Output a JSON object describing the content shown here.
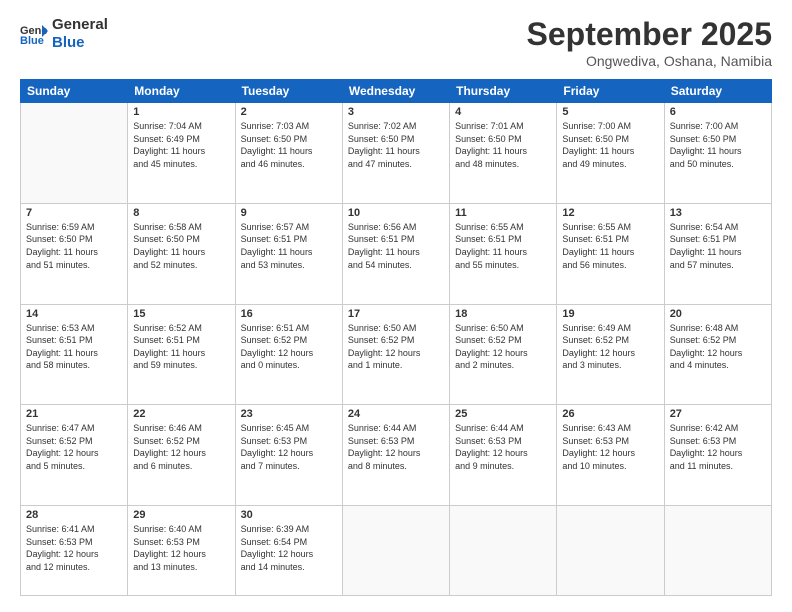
{
  "header": {
    "logo_line1": "General",
    "logo_line2": "Blue",
    "month": "September 2025",
    "location": "Ongwediva, Oshana, Namibia"
  },
  "weekdays": [
    "Sunday",
    "Monday",
    "Tuesday",
    "Wednesday",
    "Thursday",
    "Friday",
    "Saturday"
  ],
  "weeks": [
    [
      {
        "day": "",
        "text": ""
      },
      {
        "day": "1",
        "text": "Sunrise: 7:04 AM\nSunset: 6:49 PM\nDaylight: 11 hours\nand 45 minutes."
      },
      {
        "day": "2",
        "text": "Sunrise: 7:03 AM\nSunset: 6:50 PM\nDaylight: 11 hours\nand 46 minutes."
      },
      {
        "day": "3",
        "text": "Sunrise: 7:02 AM\nSunset: 6:50 PM\nDaylight: 11 hours\nand 47 minutes."
      },
      {
        "day": "4",
        "text": "Sunrise: 7:01 AM\nSunset: 6:50 PM\nDaylight: 11 hours\nand 48 minutes."
      },
      {
        "day": "5",
        "text": "Sunrise: 7:00 AM\nSunset: 6:50 PM\nDaylight: 11 hours\nand 49 minutes."
      },
      {
        "day": "6",
        "text": "Sunrise: 7:00 AM\nSunset: 6:50 PM\nDaylight: 11 hours\nand 50 minutes."
      }
    ],
    [
      {
        "day": "7",
        "text": "Sunrise: 6:59 AM\nSunset: 6:50 PM\nDaylight: 11 hours\nand 51 minutes."
      },
      {
        "day": "8",
        "text": "Sunrise: 6:58 AM\nSunset: 6:50 PM\nDaylight: 11 hours\nand 52 minutes."
      },
      {
        "day": "9",
        "text": "Sunrise: 6:57 AM\nSunset: 6:51 PM\nDaylight: 11 hours\nand 53 minutes."
      },
      {
        "day": "10",
        "text": "Sunrise: 6:56 AM\nSunset: 6:51 PM\nDaylight: 11 hours\nand 54 minutes."
      },
      {
        "day": "11",
        "text": "Sunrise: 6:55 AM\nSunset: 6:51 PM\nDaylight: 11 hours\nand 55 minutes."
      },
      {
        "day": "12",
        "text": "Sunrise: 6:55 AM\nSunset: 6:51 PM\nDaylight: 11 hours\nand 56 minutes."
      },
      {
        "day": "13",
        "text": "Sunrise: 6:54 AM\nSunset: 6:51 PM\nDaylight: 11 hours\nand 57 minutes."
      }
    ],
    [
      {
        "day": "14",
        "text": "Sunrise: 6:53 AM\nSunset: 6:51 PM\nDaylight: 11 hours\nand 58 minutes."
      },
      {
        "day": "15",
        "text": "Sunrise: 6:52 AM\nSunset: 6:51 PM\nDaylight: 11 hours\nand 59 minutes."
      },
      {
        "day": "16",
        "text": "Sunrise: 6:51 AM\nSunset: 6:52 PM\nDaylight: 12 hours\nand 0 minutes."
      },
      {
        "day": "17",
        "text": "Sunrise: 6:50 AM\nSunset: 6:52 PM\nDaylight: 12 hours\nand 1 minute."
      },
      {
        "day": "18",
        "text": "Sunrise: 6:50 AM\nSunset: 6:52 PM\nDaylight: 12 hours\nand 2 minutes."
      },
      {
        "day": "19",
        "text": "Sunrise: 6:49 AM\nSunset: 6:52 PM\nDaylight: 12 hours\nand 3 minutes."
      },
      {
        "day": "20",
        "text": "Sunrise: 6:48 AM\nSunset: 6:52 PM\nDaylight: 12 hours\nand 4 minutes."
      }
    ],
    [
      {
        "day": "21",
        "text": "Sunrise: 6:47 AM\nSunset: 6:52 PM\nDaylight: 12 hours\nand 5 minutes."
      },
      {
        "day": "22",
        "text": "Sunrise: 6:46 AM\nSunset: 6:52 PM\nDaylight: 12 hours\nand 6 minutes."
      },
      {
        "day": "23",
        "text": "Sunrise: 6:45 AM\nSunset: 6:53 PM\nDaylight: 12 hours\nand 7 minutes."
      },
      {
        "day": "24",
        "text": "Sunrise: 6:44 AM\nSunset: 6:53 PM\nDaylight: 12 hours\nand 8 minutes."
      },
      {
        "day": "25",
        "text": "Sunrise: 6:44 AM\nSunset: 6:53 PM\nDaylight: 12 hours\nand 9 minutes."
      },
      {
        "day": "26",
        "text": "Sunrise: 6:43 AM\nSunset: 6:53 PM\nDaylight: 12 hours\nand 10 minutes."
      },
      {
        "day": "27",
        "text": "Sunrise: 6:42 AM\nSunset: 6:53 PM\nDaylight: 12 hours\nand 11 minutes."
      }
    ],
    [
      {
        "day": "28",
        "text": "Sunrise: 6:41 AM\nSunset: 6:53 PM\nDaylight: 12 hours\nand 12 minutes."
      },
      {
        "day": "29",
        "text": "Sunrise: 6:40 AM\nSunset: 6:53 PM\nDaylight: 12 hours\nand 13 minutes."
      },
      {
        "day": "30",
        "text": "Sunrise: 6:39 AM\nSunset: 6:54 PM\nDaylight: 12 hours\nand 14 minutes."
      },
      {
        "day": "",
        "text": ""
      },
      {
        "day": "",
        "text": ""
      },
      {
        "day": "",
        "text": ""
      },
      {
        "day": "",
        "text": ""
      }
    ]
  ]
}
